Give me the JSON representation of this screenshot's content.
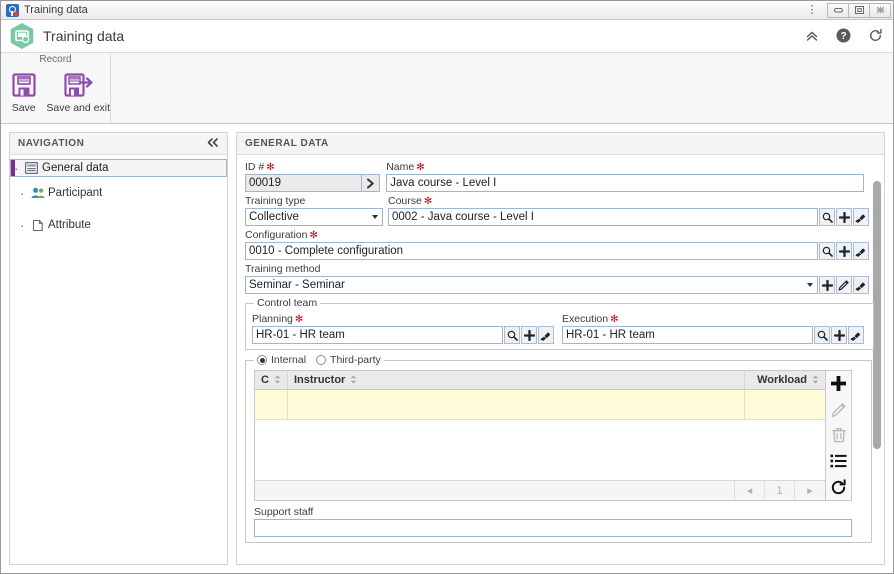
{
  "window": {
    "title": "Training data",
    "icon": "app-window-icon",
    "menu_dots": "⋮",
    "buttons": [
      {
        "name": "minimize",
        "label": "−"
      },
      {
        "name": "restore",
        "label": "□"
      },
      {
        "name": "close",
        "label": "✕"
      }
    ]
  },
  "header": {
    "title": "Training data",
    "icon": "training-hexagon-icon",
    "actions": [
      {
        "name": "collapse-ribbon-icon",
        "glyph": "«"
      },
      {
        "name": "help-icon",
        "glyph": "?"
      },
      {
        "name": "refresh-icon",
        "glyph": "↻"
      }
    ]
  },
  "ribbon": {
    "group_title": "Record",
    "buttons": [
      {
        "name": "save-button",
        "label": "Save"
      },
      {
        "name": "save-and-exit-button",
        "label": "Save and exit"
      }
    ]
  },
  "navigation": {
    "title": "NAVIGATION",
    "collapse_glyph": "«",
    "items": [
      {
        "label": "General data",
        "icon": "general-data-icon",
        "selected": true
      },
      {
        "label": "Participant",
        "icon": "participant-icon",
        "selected": false
      },
      {
        "label": "Attribute",
        "icon": "attribute-icon",
        "selected": false
      }
    ]
  },
  "content": {
    "title": "GENERAL DATA",
    "required_marker": "✻",
    "fields": {
      "id": {
        "label": "ID #",
        "value": "00019",
        "required": true,
        "readonly": true,
        "go_glyph": "❯"
      },
      "name": {
        "label": "Name",
        "value": "Java course - Level I",
        "required": true
      },
      "training_type": {
        "label": "Training type",
        "value": "Collective",
        "required": false
      },
      "course": {
        "label": "Course",
        "value": "0002 - Java course - Level I",
        "required": true
      },
      "configuration": {
        "label": "Configuration",
        "value": "0010 - Complete configuration",
        "required": true
      },
      "training_method": {
        "label": "Training method",
        "value": "Seminar - Seminar",
        "required": false
      },
      "support_staff": {
        "label": "Support staff",
        "value": ""
      }
    },
    "control_team": {
      "legend": "Control team",
      "planning": {
        "label": "Planning",
        "value": "HR-01 - HR team",
        "required": true
      },
      "execution": {
        "label": "Execution",
        "value": "HR-01 - HR team",
        "required": true
      }
    },
    "instructor_source": {
      "options": [
        {
          "label": "Internal",
          "selected": true
        },
        {
          "label": "Third-party",
          "selected": false
        }
      ]
    },
    "instructor_grid": {
      "columns": [
        {
          "label": "C",
          "name": "column-c"
        },
        {
          "label": "Instructor",
          "name": "column-instructor"
        },
        {
          "label": "Workload",
          "name": "column-workload"
        }
      ],
      "rows": [
        {
          "c": "",
          "instructor": "",
          "workload": ""
        }
      ],
      "pagination": {
        "prev": "◂",
        "page": "1",
        "next": "▸"
      },
      "tools": [
        {
          "name": "add-row-button",
          "glyph": "+"
        },
        {
          "name": "edit-row-button",
          "glyph": "✎"
        },
        {
          "name": "delete-row-button",
          "glyph": "Ὕ1"
        },
        {
          "name": "list-options-button",
          "glyph": "☰"
        },
        {
          "name": "refresh-grid-button",
          "glyph": "↻"
        }
      ]
    },
    "field_actions": {
      "search": "search-icon",
      "add": "add-icon",
      "edit": "edit-icon",
      "clear": "clear-brush-icon"
    }
  },
  "colors": {
    "accent": "#7b2d8e",
    "required": "#d0021b",
    "grid_row": "#fdfbd8",
    "hex_icon": "#6cc39b"
  }
}
